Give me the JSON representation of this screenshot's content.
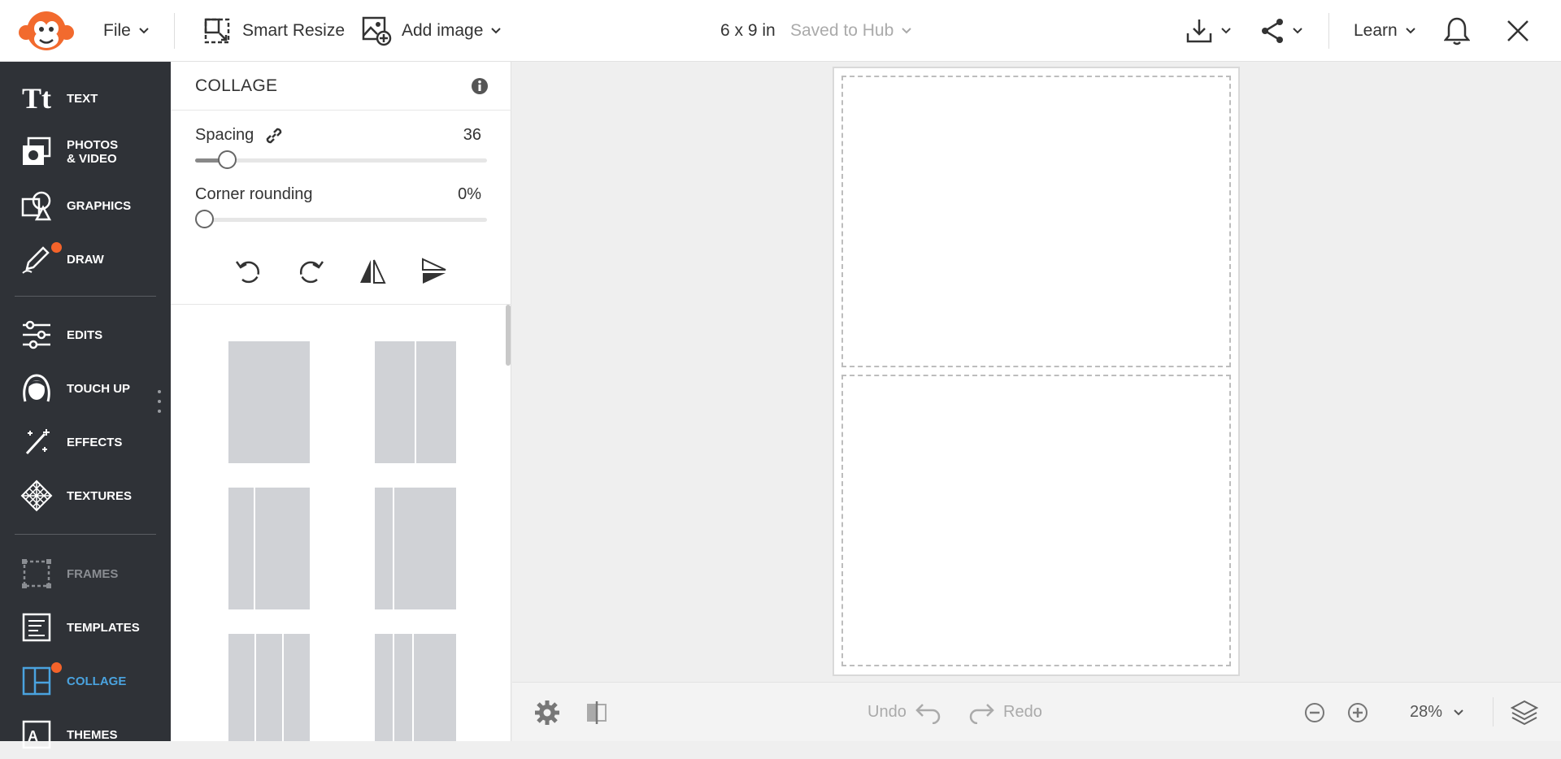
{
  "topbar": {
    "file_label": "File",
    "smart_resize_label": "Smart Resize",
    "add_image_label": "Add image",
    "doc_size": "6 x 9 in",
    "save_status": "Saved to Hub",
    "learn_label": "Learn"
  },
  "sidebar": {
    "items": [
      {
        "label": "TEXT"
      },
      {
        "label": "PHOTOS\n& VIDEO"
      },
      {
        "label": "GRAPHICS"
      },
      {
        "label": "DRAW"
      },
      {
        "label": "EDITS"
      },
      {
        "label": "TOUCH UP"
      },
      {
        "label": "EFFECTS"
      },
      {
        "label": "TEXTURES"
      },
      {
        "label": "FRAMES"
      },
      {
        "label": "TEMPLATES"
      },
      {
        "label": "COLLAGE"
      },
      {
        "label": "THEMES"
      }
    ]
  },
  "panel": {
    "title": "COLLAGE",
    "spacing_label": "Spacing",
    "spacing_value": "36",
    "spacing_level": 0.11,
    "corner_label": "Corner rounding",
    "corner_value": "0%",
    "corner_level": 0
  },
  "bottombar": {
    "undo_label": "Undo",
    "redo_label": "Redo",
    "zoom": "28%"
  },
  "colors": {
    "accent": "#4aa3df",
    "badge": "#f4632a",
    "sidebar_bg": "#2f3237"
  }
}
